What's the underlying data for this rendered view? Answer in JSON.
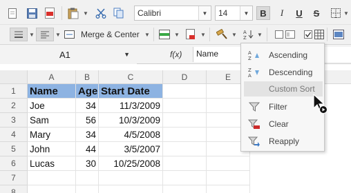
{
  "toolbar_top": {
    "font_name": "Calibri",
    "font_size": "14",
    "bold": "B",
    "italic": "I",
    "underline": "U",
    "strike": "S"
  },
  "toolbar_second": {
    "merge_label": "Merge & Center"
  },
  "formula_bar": {
    "cell_ref": "A1",
    "fx_label": "f(x)",
    "value": "Name"
  },
  "sheet": {
    "columns": [
      "A",
      "B",
      "C",
      "D",
      "E"
    ],
    "rows": [
      "1",
      "2",
      "3",
      "4",
      "5",
      "6",
      "7",
      "8"
    ],
    "header": {
      "name": "Name",
      "age": "Age",
      "start": "Start Date"
    },
    "data": [
      {
        "name": "Joe",
        "age": "34",
        "start": "11/3/2009"
      },
      {
        "name": "Sam",
        "age": "56",
        "start": "10/3/2009"
      },
      {
        "name": "Mary",
        "age": "34",
        "start": "4/5/2008"
      },
      {
        "name": "John",
        "age": "44",
        "start": "3/5/2007"
      },
      {
        "name": "Lucas",
        "age": "30",
        "start": "10/25/2008"
      }
    ]
  },
  "sort_menu": {
    "items": [
      {
        "label": "Ascending",
        "icon": "sort-ascending-icon"
      },
      {
        "label": "Descending",
        "icon": "sort-descending-icon"
      },
      {
        "label": "Custom Sort",
        "icon": ""
      },
      {
        "label": "Filter",
        "icon": "filter-icon"
      },
      {
        "label": "Clear",
        "icon": "filter-clear-icon"
      },
      {
        "label": "Reapply",
        "icon": "filter-reapply-icon"
      }
    ],
    "highlighted": "Custom Sort"
  },
  "colors": {
    "header_fill": "#8db3e2",
    "toolbar_bg": "#f1f1f1"
  }
}
